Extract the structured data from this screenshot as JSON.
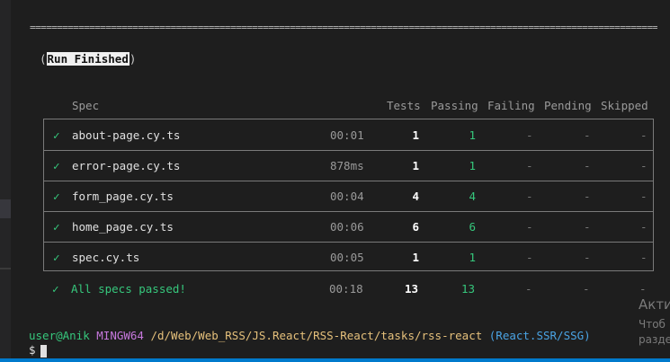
{
  "divider": "========================================================================================================================",
  "run_finished": "Run Finished",
  "columns": {
    "spec": "Spec",
    "tests": "Tests",
    "passing": "Passing",
    "failing": "Failing",
    "pending": "Pending",
    "skipped": "Skipped"
  },
  "rows": [
    {
      "status": "✓",
      "spec": "about-page.cy.ts",
      "duration": "00:01",
      "tests": "1",
      "passing": "1",
      "failing": "-",
      "pending": "-",
      "skipped": "-"
    },
    {
      "status": "✓",
      "spec": "error-page.cy.ts",
      "duration": "878ms",
      "tests": "1",
      "passing": "1",
      "failing": "-",
      "pending": "-",
      "skipped": "-"
    },
    {
      "status": "✓",
      "spec": "form_page.cy.ts",
      "duration": "00:04",
      "tests": "4",
      "passing": "4",
      "failing": "-",
      "pending": "-",
      "skipped": "-"
    },
    {
      "status": "✓",
      "spec": "home_page.cy.ts",
      "duration": "00:06",
      "tests": "6",
      "passing": "6",
      "failing": "-",
      "pending": "-",
      "skipped": "-"
    },
    {
      "status": "✓",
      "spec": "spec.cy.ts",
      "duration": "00:05",
      "tests": "1",
      "passing": "1",
      "failing": "-",
      "pending": "-",
      "skipped": "-"
    }
  ],
  "summary": {
    "status": "✓",
    "label": "All specs passed!",
    "duration": "00:18",
    "tests": "13",
    "passing": "13",
    "failing": "-",
    "pending": "-",
    "skipped": "-"
  },
  "prompt": {
    "user": "user@Anik",
    "host": "MINGW64",
    "path": "/d/Web/Web_RSS/JS.React/RSS-React/tasks/rss-react",
    "branch": "(React.SSR/SSG)",
    "symbol": "$"
  },
  "watermark": {
    "line1": "Акти",
    "line2": "Чтоб",
    "line3": "разде"
  },
  "colors": {
    "background": "#1e1e1e",
    "pass": "#36c77c",
    "host": "#c678dd",
    "path": "#e5c07b",
    "branch": "#4aa3e3",
    "accent": "#007acc"
  }
}
